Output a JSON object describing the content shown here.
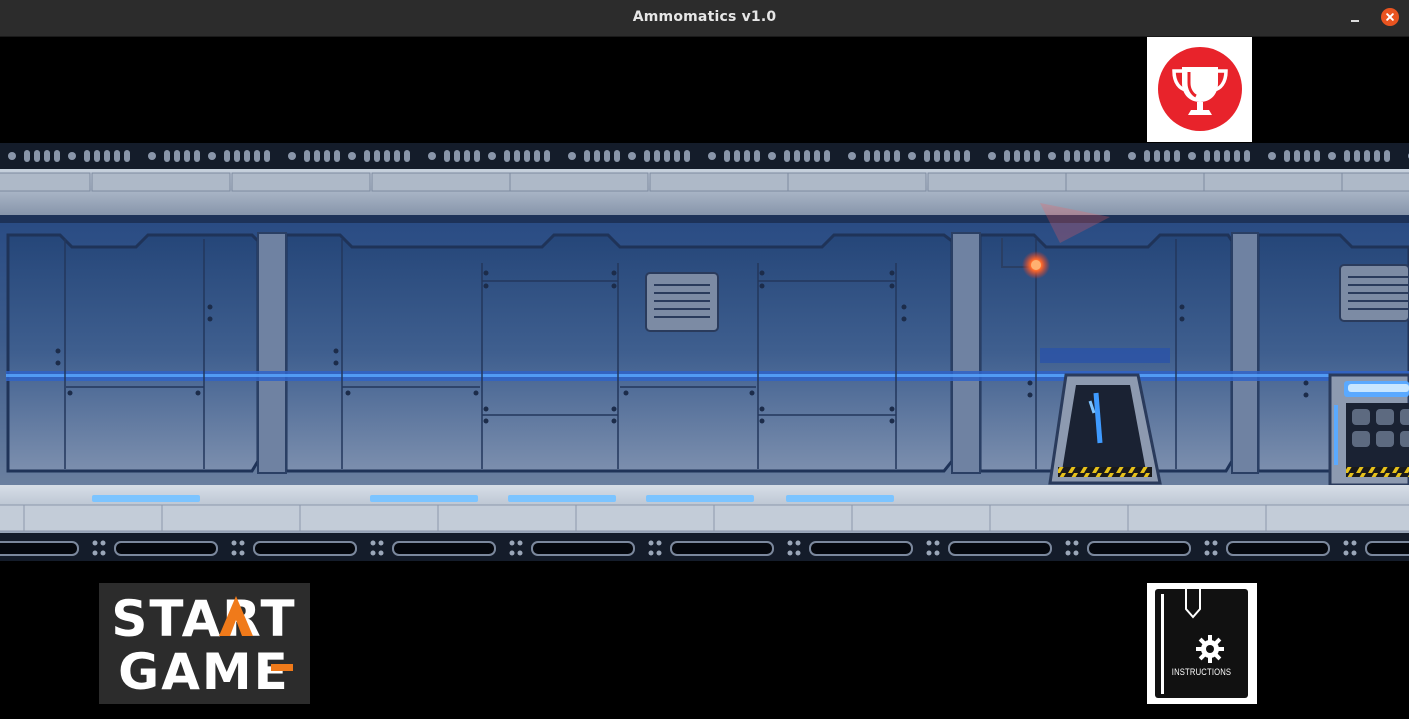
{
  "window": {
    "title": "Ammomatics v1.0",
    "controls": [
      "minimize",
      "close"
    ]
  },
  "menu": {
    "leaderboard_icon": "trophy-icon",
    "start_button": {
      "line1": "START",
      "line2": "GAME"
    },
    "instructions_button": {
      "label": "INSTRUCTIONS",
      "icon": "gear-icon"
    }
  },
  "scene": {
    "description_icon": "sci-fi-corridor"
  },
  "colors": {
    "titlebar": "#2c2c2c",
    "close": "#e95420",
    "trophy_disc": "#e8232b",
    "start_accent": "#f07a1a",
    "corridor_light": "#5aa9ff"
  }
}
